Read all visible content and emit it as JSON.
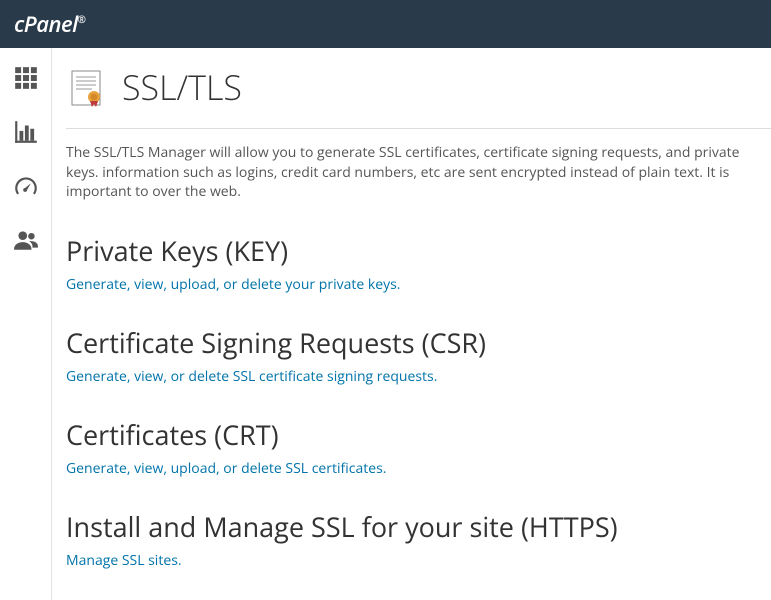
{
  "brand": "cPanel",
  "page": {
    "title": "SSL/TLS",
    "intro": "The SSL/TLS Manager will allow you to generate SSL certificates, certificate signing requests, and private keys. information such as logins, credit card numbers, etc are sent encrypted instead of plain text. It is important to over the web."
  },
  "sections": [
    {
      "title": "Private Keys (KEY)",
      "link": "Generate, view, upload, or delete your private keys."
    },
    {
      "title": "Certificate Signing Requests (CSR)",
      "link": "Generate, view, or delete SSL certificate signing requests."
    },
    {
      "title": "Certificates (CRT)",
      "link": "Generate, view, upload, or delete SSL certificates."
    },
    {
      "title": "Install and Manage SSL for your site (HTTPS)",
      "link": "Manage SSL sites."
    }
  ]
}
